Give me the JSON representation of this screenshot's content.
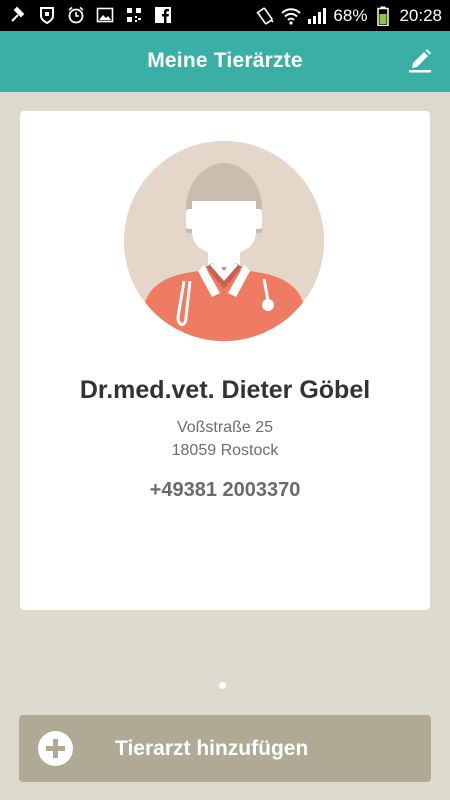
{
  "status_bar": {
    "battery_percent": "68%",
    "time": "20:28",
    "icons": [
      "bug-icon",
      "shield-icon",
      "alarm-icon",
      "image-icon",
      "qr-icon",
      "facebook-icon",
      "vibrate-icon",
      "wifi-icon",
      "signal-icon",
      "battery-icon"
    ]
  },
  "appbar": {
    "title": "Meine Tierärzte",
    "action_icon": "edit-icon"
  },
  "vet_card": {
    "name": "Dr.med.vet. Dieter Göbel",
    "street": "Voßstraße 25",
    "city": "18059 Rostock",
    "phone": "+49381 2003370",
    "avatar_icon": "veterinarian-avatar-icon"
  },
  "pager": {
    "current_page": 1,
    "total_pages": 1
  },
  "add_button": {
    "label": "Tierarzt hinzufügen",
    "icon": "plus-circle-icon"
  },
  "colors": {
    "appbar": "#3aafa6",
    "background": "#dcd9cd",
    "button": "#b0aa94",
    "scrubs": "#ee7b62",
    "avatar_bg": "#e4d6c9"
  }
}
